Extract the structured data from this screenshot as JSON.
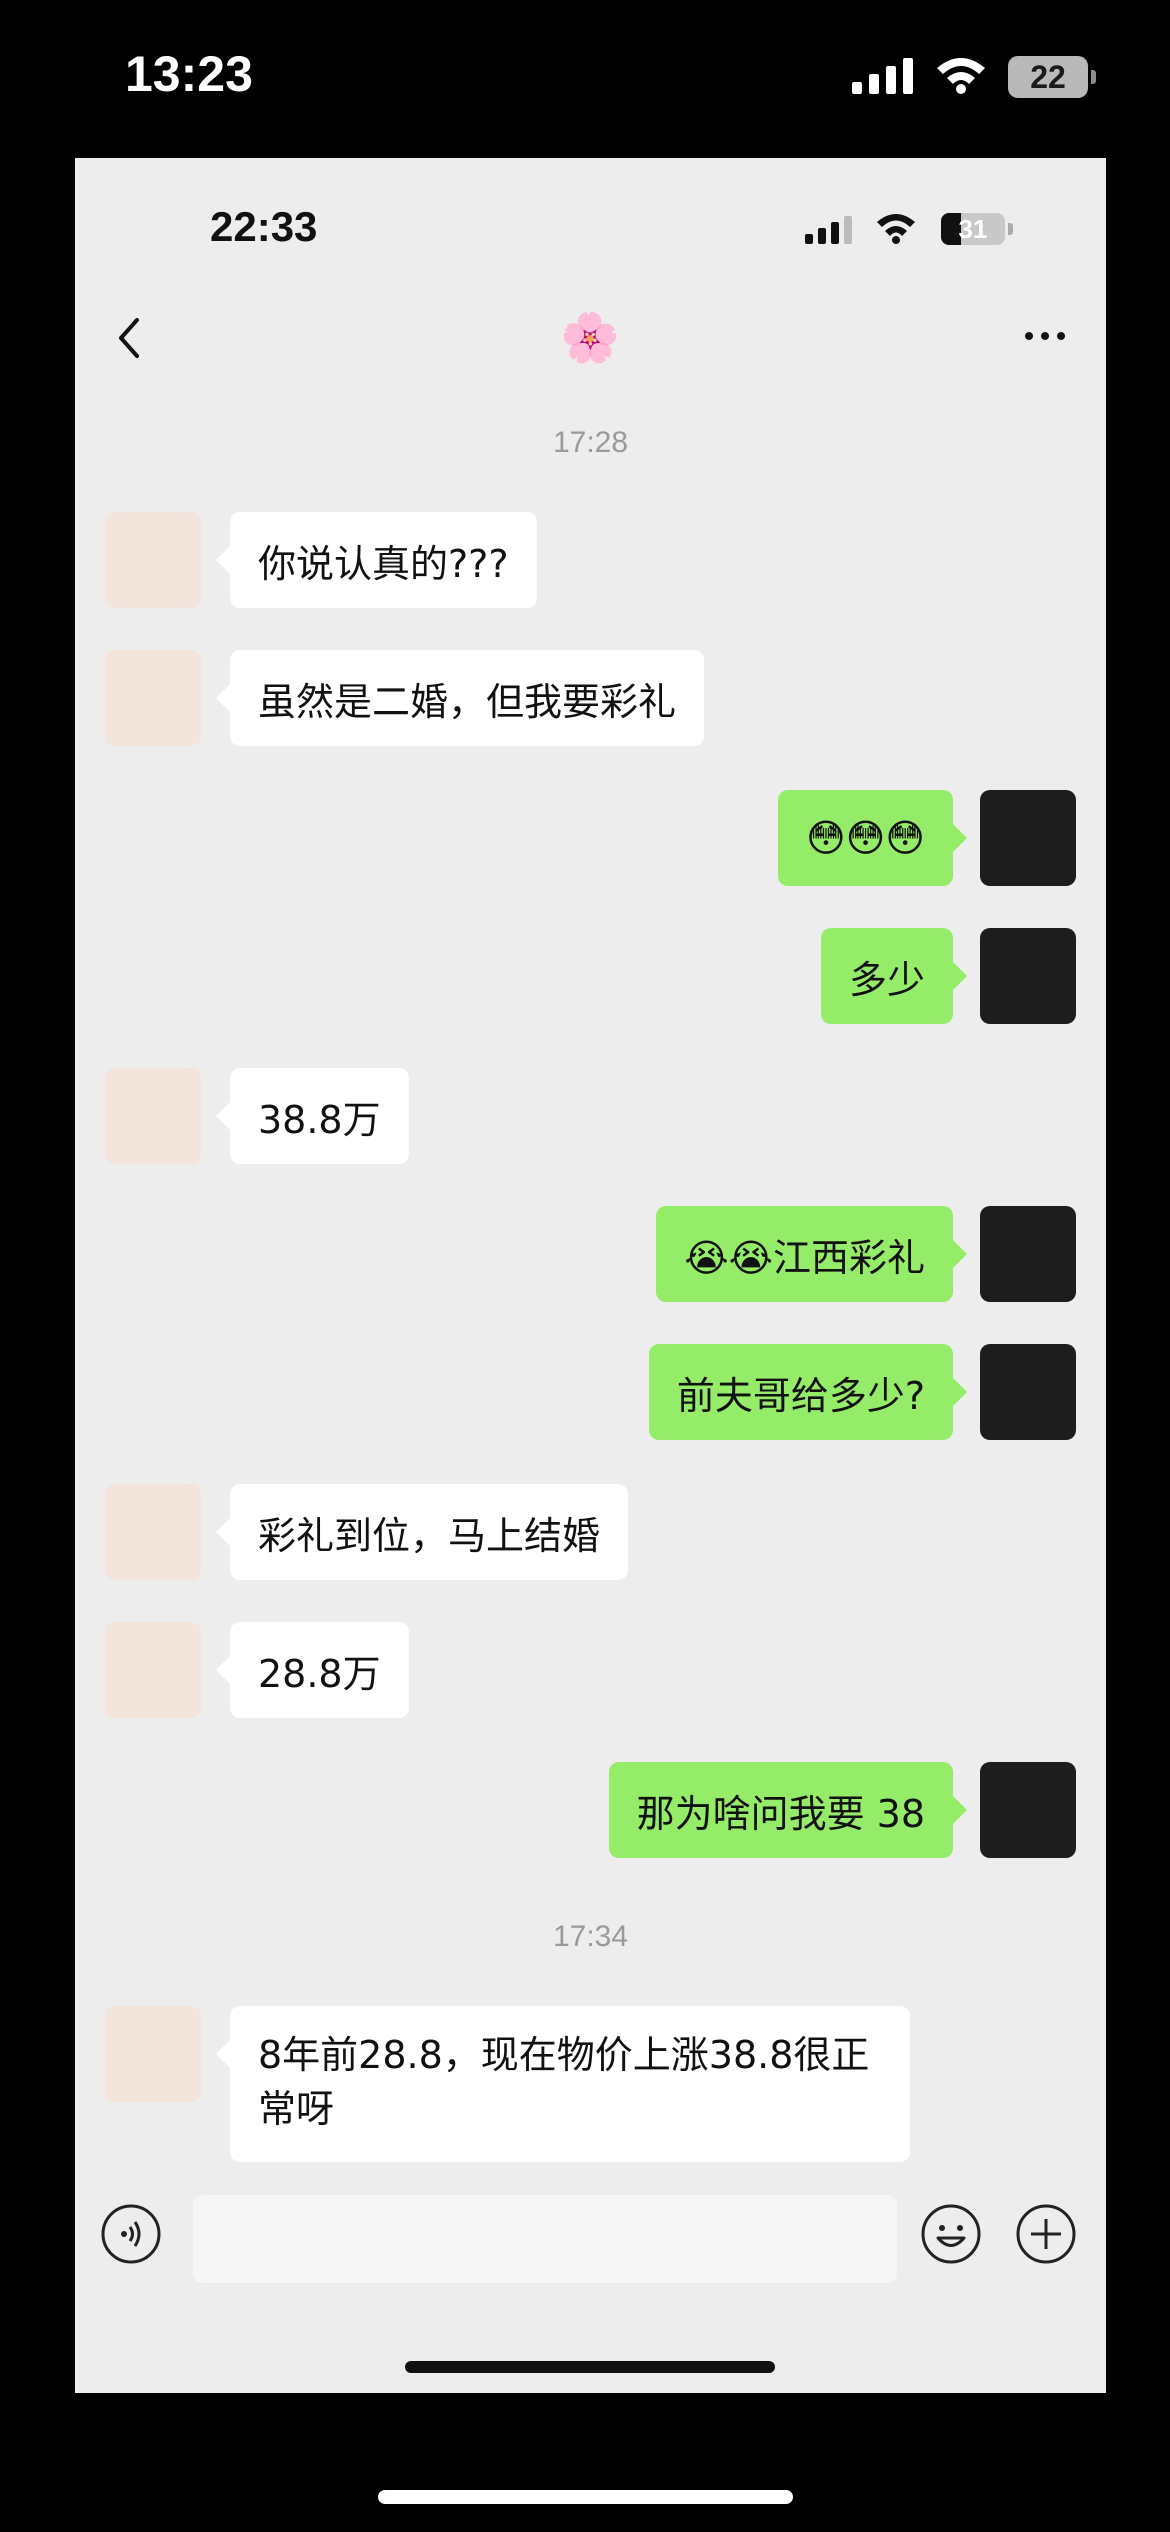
{
  "outer_status": {
    "time": "13:23",
    "battery": "22"
  },
  "inner_status": {
    "time": "22:33",
    "battery": "31",
    "battery_level": 0.31
  },
  "nav": {
    "title": "🌸"
  },
  "timestamps": {
    "first": "17:28",
    "second": "17:34"
  },
  "messages": [
    {
      "side": "left",
      "text": "你说认真的???"
    },
    {
      "side": "left",
      "text": "虽然是二婚，但我要彩礼"
    },
    {
      "side": "right",
      "text": "😳😳😳"
    },
    {
      "side": "right",
      "text": "多少"
    },
    {
      "side": "left",
      "text": "38.8万"
    },
    {
      "side": "right",
      "text": "😭😭江西彩礼"
    },
    {
      "side": "right",
      "text": "前夫哥给多少?"
    },
    {
      "side": "left",
      "text": "彩礼到位，马上结婚"
    },
    {
      "side": "left",
      "text": "28.8万"
    },
    {
      "side": "right",
      "text": "那为啥问我要 38"
    },
    {
      "side": "left",
      "text": "8年前28.8，现在物价上涨38.8很正常呀"
    }
  ],
  "input": {
    "placeholder": ""
  },
  "colors": {
    "self_bubble": "#95ec69",
    "other_bubble": "#ffffff",
    "chat_bg": "#ededed"
  }
}
